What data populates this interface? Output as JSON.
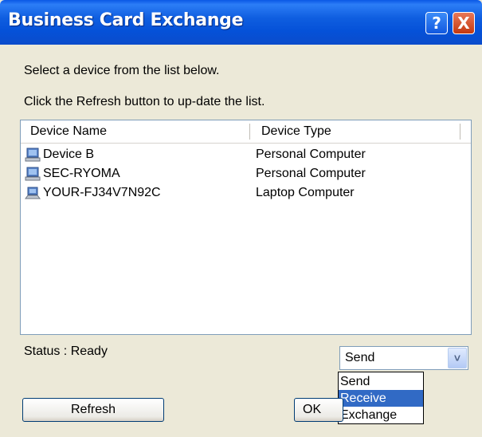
{
  "window": {
    "title": "Business Card Exchange",
    "help_glyph": "?",
    "close_glyph": "X"
  },
  "instructions": {
    "line1": "Select a device from the list below.",
    "line2": "Click the Refresh button to up-date the list."
  },
  "device_list": {
    "columns": [
      "Device Name",
      "Device Type"
    ],
    "rows": [
      {
        "name": "Device B",
        "type": "Personal Computer",
        "icon": "desktop-computer-icon"
      },
      {
        "name": "SEC-RYOMA",
        "type": "Personal Computer",
        "icon": "desktop-computer-icon"
      },
      {
        "name": "YOUR-FJ34V7N92C",
        "type": "Laptop Computer",
        "icon": "laptop-computer-icon"
      }
    ]
  },
  "status": {
    "text": "Status : Ready"
  },
  "mode_select": {
    "selected": "Send",
    "arrow_glyph": "˅",
    "options": [
      "Send",
      "Receive",
      "Exchange"
    ],
    "highlighted_option": "Receive"
  },
  "buttons": {
    "refresh": "Refresh",
    "ok": "OK"
  },
  "colors": {
    "title_bar": "#0A58E6",
    "dialog_bg": "#ECE9D8",
    "selection": "#316AC5"
  }
}
